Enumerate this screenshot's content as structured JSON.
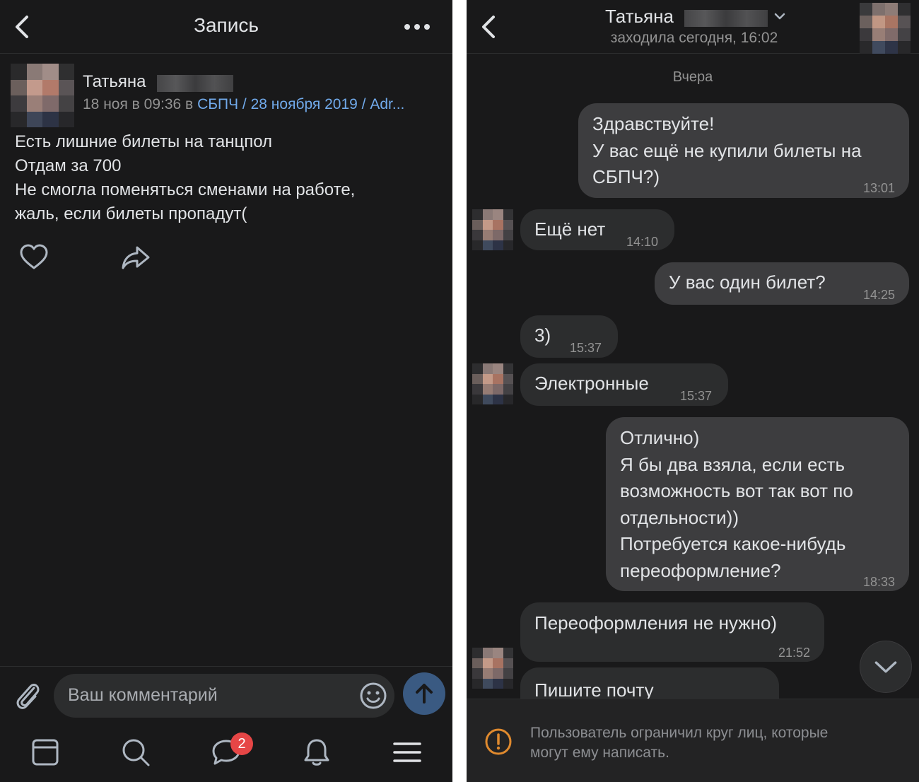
{
  "left": {
    "header": {
      "title": "Запись"
    },
    "post": {
      "author": "Татьяна",
      "meta_prefix": "18 ноя в 09:36 в",
      "meta_link": "СБПЧ / 28 ноября 2019 / Adr...",
      "text_lines": [
        "Есть лишние билеты на танцпол",
        "Отдам за 700",
        "Не смогла поменяться сменами на работе,",
        "жаль, если билеты пропадут("
      ]
    },
    "composer": {
      "placeholder": "Ваш комментарий"
    },
    "tabbar": {
      "messages_badge": "2"
    }
  },
  "right": {
    "header": {
      "name": "Татьяна",
      "status": "заходила сегодня, 16:02"
    },
    "date_separator": "Вчера",
    "messages": [
      {
        "dir": "out",
        "lines": [
          "Здравствуйте!",
          "У вас ещё не купили билеты на",
          "СБПЧ?)"
        ],
        "time": "13:01"
      },
      {
        "dir": "in",
        "lines": [
          "Ещё нет"
        ],
        "time": "14:10"
      },
      {
        "dir": "out",
        "lines": [
          "У вас один билет?"
        ],
        "time": "14:25"
      },
      {
        "dir": "in",
        "lines": [
          "3)"
        ],
        "time": "15:37"
      },
      {
        "dir": "in",
        "lines": [
          "Электронные"
        ],
        "time": "15:37"
      },
      {
        "dir": "out",
        "lines": [
          "Отлично)",
          "Я бы два взяла, если есть",
          "возможность вот так вот по",
          "отдельности))",
          "Потребуется какое-нибудь",
          "переоформление?"
        ],
        "time": "18:33"
      },
      {
        "dir": "in",
        "lines": [
          "Переоформления не нужно)"
        ],
        "time": "21:52"
      },
      {
        "dir": "in",
        "lines": [
          "Пишите почту"
        ],
        "time": ""
      }
    ],
    "notice_lines": [
      "Пользователь ограничил круг лиц, которые",
      "могут ему написать."
    ]
  },
  "colors": {
    "background": "#19191a",
    "bubble_in": "#2c2d2e",
    "bubble_out": "#3d3d3f",
    "link": "#71aaeb",
    "badge": "#e64646",
    "send": "#3a5a82",
    "warning": "#e08a2e"
  },
  "icons": [
    "back-icon",
    "more-icon",
    "like-icon",
    "share-icon",
    "paperclip-icon",
    "emoji-icon",
    "send-arrow-icon",
    "news-icon",
    "search-icon",
    "messages-icon",
    "bell-icon",
    "menu-icon",
    "chevron-down-icon",
    "warning-icon"
  ]
}
